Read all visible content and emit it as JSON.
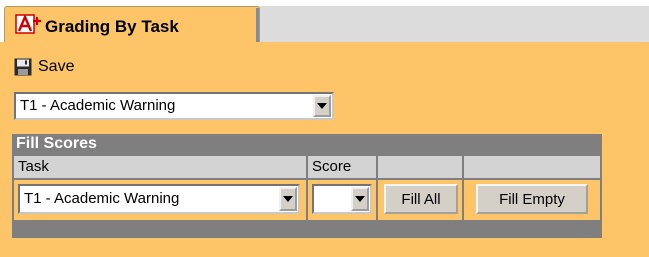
{
  "tab": {
    "label": "Grading By Task",
    "icon": "grade-aplus-icon"
  },
  "toolbar": {
    "save_label": "Save",
    "save_icon": "floppy-disk-icon"
  },
  "task_selector": {
    "value": "T1 - Academic Warning"
  },
  "fill_scores": {
    "title": "Fill Scores",
    "columns": {
      "task": "Task",
      "score": "Score"
    },
    "task_value": "T1 - Academic Warning",
    "score_value": "",
    "fill_all_label": "Fill All",
    "fill_empty_label": "Fill Empty"
  },
  "colors": {
    "panel": "#fdc568",
    "header": "#7f7f7f",
    "tabstrip": "#dcdcdc"
  }
}
